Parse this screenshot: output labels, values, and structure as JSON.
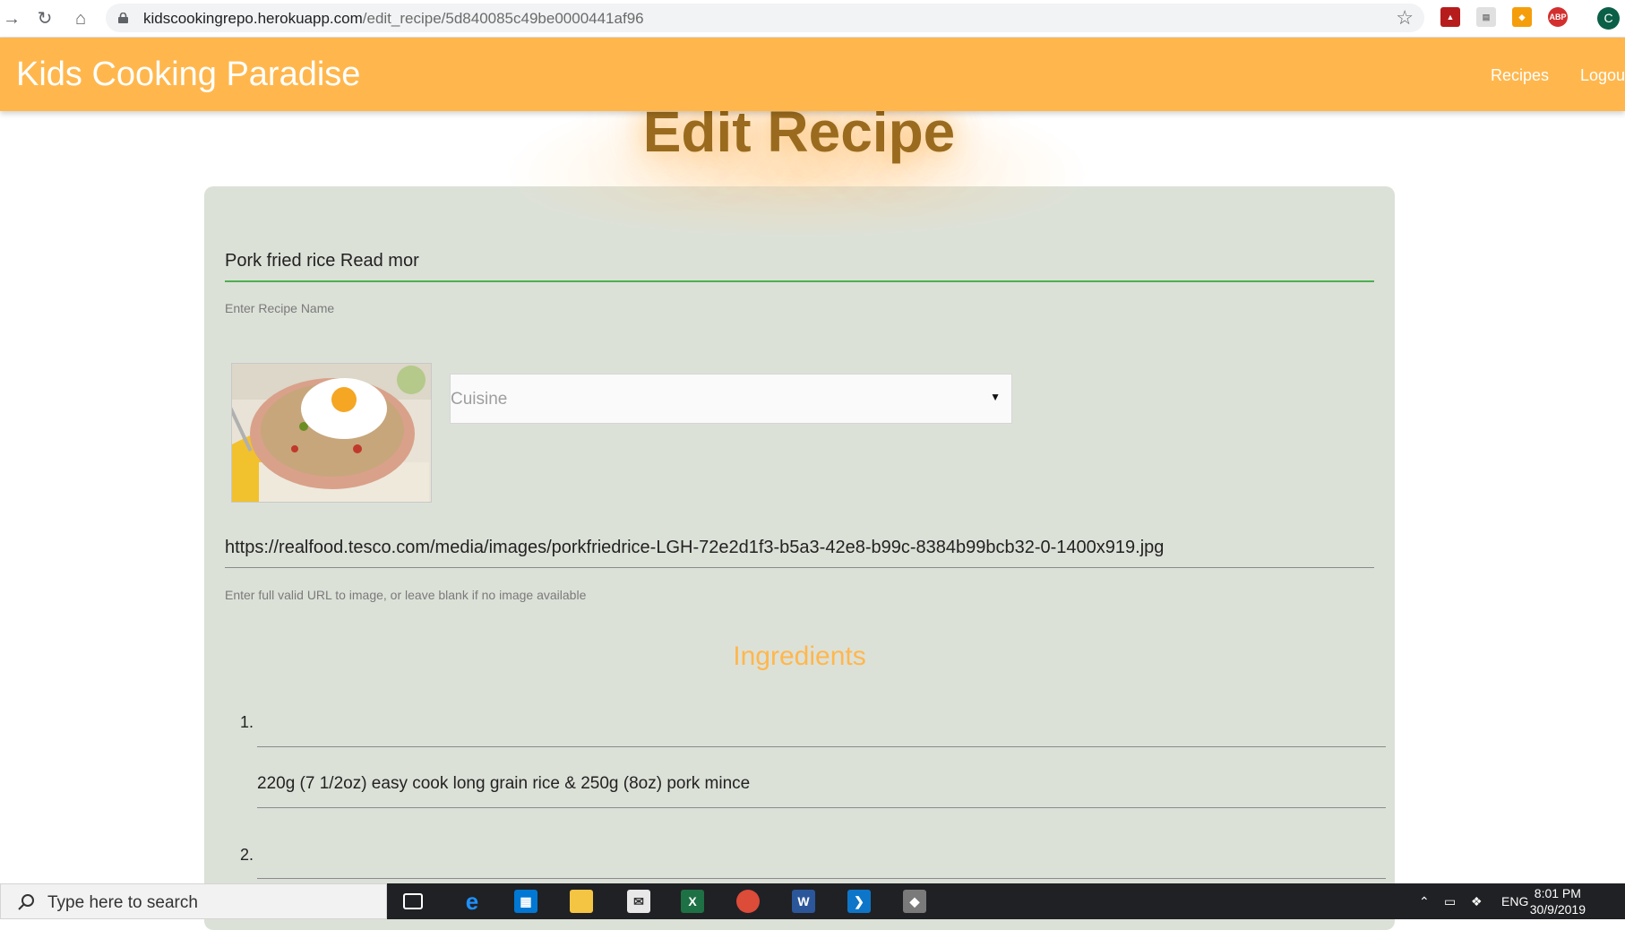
{
  "browser": {
    "url_host": "kidscookingrepo.herokuapp.com",
    "url_path": "/edit_recipe/5d840085c49be0000441af96",
    "profile_initial": "C",
    "ext_abp_label": "ABP"
  },
  "header": {
    "brand": "Kids Cooking Paradise",
    "nav": {
      "recipes": "Recipes",
      "logout": "Logou"
    },
    "brand_color": "#ffb74d"
  },
  "page": {
    "title": "Edit Recipe",
    "recipe_name": {
      "value": "Pork fried rice Read mor",
      "helper": "Enter Recipe Name"
    },
    "cuisine": {
      "placeholder": "Cuisine"
    },
    "image_url": {
      "value": "https://realfood.tesco.com/media/images/porkfriedrice-LGH-72e2d1f3-b5a3-42e8-b99c-8384b99bcb32-0-1400x919.jpg",
      "helper": "Enter full valid URL to image, or leave blank if no image available"
    },
    "ingredients": {
      "title": "Ingredients",
      "items": [
        {
          "num": "1.",
          "value": "220g (7 1/2oz) easy cook long grain rice  & 250g (8oz) pork mince"
        },
        {
          "num": "2.",
          "value": ""
        }
      ]
    }
  },
  "taskbar": {
    "search_placeholder": "Type here to search",
    "language": "ENG",
    "time": "8:01 PM",
    "date": "30/9/2019"
  }
}
